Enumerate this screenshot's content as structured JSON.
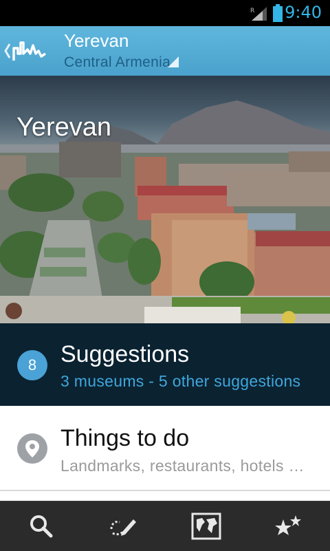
{
  "status_bar": {
    "time": "9:40",
    "roaming": "R",
    "icons": [
      "signal-icon",
      "battery-icon"
    ]
  },
  "action_bar": {
    "title": "Yerevan",
    "subtitle": "Central Armenia",
    "icons": [
      "back-chevron-icon",
      "city-skyline-icon",
      "spinner-triangle-icon"
    ]
  },
  "hero": {
    "title": "Yerevan"
  },
  "suggestions": {
    "count": "8",
    "title": "Suggestions",
    "subtitle": "3 museums - 5 other suggestions"
  },
  "things_to_do": {
    "title": "Things to do",
    "subtitle": "Landmarks, restaurants, hotels …",
    "icon": "map-pin-icon"
  },
  "toolbar": {
    "items": [
      "search-icon",
      "trip-pen-icon",
      "world-map-icon",
      "favorite-stars-icon"
    ]
  },
  "colors": {
    "accent": "#4aa2d6",
    "action_bar": "#5fb6dd",
    "suggestions_bg": "#0b2231",
    "toolbar_bg": "#2b2b2b",
    "status_text": "#33b5e5"
  }
}
